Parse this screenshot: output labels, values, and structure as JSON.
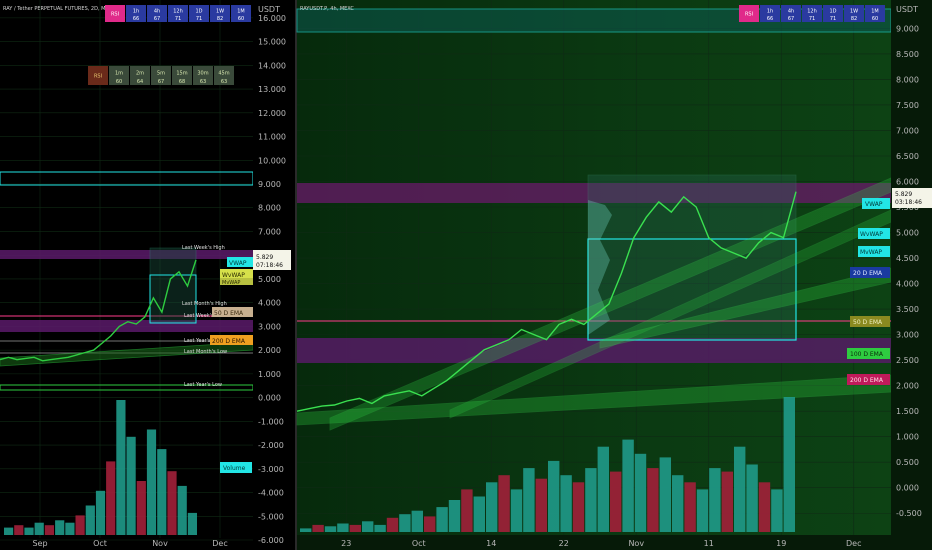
{
  "left_panel": {
    "title": "RAY / Tether PERPETUAL FUTURES, 2D, MEXC",
    "price_axis_title": "USDT",
    "rsi_row_top": {
      "label": "RSI",
      "cells": [
        {
          "tf": "1h",
          "val": "66"
        },
        {
          "tf": "4h",
          "val": "67"
        },
        {
          "tf": "12h",
          "val": "71"
        },
        {
          "tf": "1D",
          "val": "71"
        },
        {
          "tf": "1W",
          "val": "82"
        },
        {
          "tf": "1M",
          "val": "60"
        }
      ]
    },
    "rsi_row_mid": {
      "label": "RSI",
      "cells": [
        {
          "tf": "1m",
          "val": "60"
        },
        {
          "tf": "2m",
          "val": "64"
        },
        {
          "tf": "5m",
          "val": "67"
        },
        {
          "tf": "15m",
          "val": "68"
        },
        {
          "tf": "30m",
          "val": "63"
        },
        {
          "tf": "45m",
          "val": "63"
        }
      ]
    },
    "price_label": {
      "price": "5.829",
      "countdown": "07:18:46"
    },
    "level_tags": [
      {
        "text": "VWAP",
        "kind": "cyan"
      },
      {
        "text": "WvWAP",
        "kind": "yellow"
      },
      {
        "text": "MvWAP",
        "kind": "yellow"
      },
      {
        "text": "50 D EMA",
        "kind": "tan"
      },
      {
        "text": "200 D EMA",
        "kind": "orange"
      }
    ],
    "level_texts": [
      "Last Week's High",
      "Last Month's High",
      "Last Week's Low",
      "Last Year's High",
      "Last Month's Low",
      "Last Year's Low"
    ],
    "volume_label": "Volume"
  },
  "right_panel": {
    "title": "RAYUSDT.P, 4h, MEXC",
    "price_axis_title": "USDT",
    "rsi_row": {
      "label": "RSI",
      "cells": [
        {
          "tf": "1h",
          "val": "66"
        },
        {
          "tf": "4h",
          "val": "67"
        },
        {
          "tf": "12h",
          "val": "71"
        },
        {
          "tf": "1D",
          "val": "71"
        },
        {
          "tf": "1W",
          "val": "82"
        },
        {
          "tf": "1M",
          "val": "60"
        }
      ]
    },
    "price_label": {
      "price": "5.829",
      "countdown": "03:18:46"
    },
    "level_tags": [
      {
        "text": "VWAP",
        "kind": "cyan"
      },
      {
        "text": "WvWAP",
        "kind": "cyan"
      },
      {
        "text": "MvWAP",
        "kind": "cyan"
      },
      {
        "text": "20 D EMA",
        "kind": "blue"
      },
      {
        "text": "50 D EMA",
        "kind": "olive"
      },
      {
        "text": "100 D EMA",
        "kind": "green"
      },
      {
        "text": "200 D EMA",
        "kind": "pink"
      }
    ]
  },
  "chart_data": [
    {
      "type": "line",
      "title": "RAY / Tether PERPETUAL FUTURES, 2D, MEXC",
      "xlabel": "",
      "ylabel": "USDT",
      "x_ticks": [
        "Sep",
        "Oct",
        "Nov",
        "Dec"
      ],
      "y_ticks": [
        "16.000",
        "15.000",
        "14.000",
        "13.000",
        "12.000",
        "11.000",
        "10.000",
        "9.000",
        "8.000",
        "7.000",
        "6.000",
        "5.000",
        "4.000",
        "3.000",
        "2.000",
        "1.000",
        "0.000",
        "-1.000",
        "-2.000",
        "-3.000",
        "-4.000",
        "-5.000",
        "-6.000"
      ],
      "ylim": [
        -6,
        16.5
      ],
      "series": [
        {
          "values": [
            1.6,
            1.7,
            1.6,
            1.65,
            1.7,
            1.55,
            1.6,
            1.65,
            1.7,
            1.8,
            1.9,
            2.0,
            2.3,
            2.6,
            3.0,
            3.2,
            3.1,
            3.4,
            4.2,
            3.6,
            5.0,
            5.3,
            4.7,
            5.8
          ]
        }
      ],
      "volume": [
        0.3,
        0.4,
        0.3,
        0.5,
        0.4,
        0.6,
        0.5,
        0.8,
        1.2,
        1.8,
        3.0,
        5.5,
        4.0,
        2.2,
        4.3,
        3.5,
        2.6,
        2.0,
        0.9
      ],
      "grid": true
    },
    {
      "type": "line",
      "title": "RAYUSDT.P, 4h, MEXC",
      "xlabel": "",
      "ylabel": "USDT",
      "x_ticks": [
        "23",
        "Oct",
        "14",
        "22",
        "Nov",
        "11",
        "19",
        "Dec"
      ],
      "y_ticks": [
        "9.000",
        "8.500",
        "8.000",
        "7.500",
        "7.000",
        "6.500",
        "6.000",
        "5.500",
        "5.000",
        "4.500",
        "4.000",
        "3.500",
        "3.000",
        "2.500",
        "2.000",
        "1.500",
        "1.000",
        "0.500",
        "0.000",
        "-0.500"
      ],
      "ylim": [
        -0.75,
        9.4
      ],
      "series": [
        {
          "values": [
            1.5,
            1.55,
            1.6,
            1.62,
            1.7,
            1.75,
            1.65,
            1.8,
            1.85,
            1.9,
            1.8,
            1.95,
            2.1,
            2.3,
            2.5,
            2.7,
            2.8,
            2.9,
            3.1,
            3.0,
            2.9,
            3.2,
            3.3,
            3.2,
            3.4,
            3.6,
            4.2,
            4.9,
            5.3,
            5.6,
            5.4,
            5.7,
            5.5,
            4.9,
            4.7,
            4.6,
            4.5,
            4.8,
            5.0,
            4.9,
            5.8
          ]
        }
      ],
      "volume": [
        0.05,
        0.1,
        0.08,
        0.12,
        0.1,
        0.15,
        0.1,
        0.2,
        0.25,
        0.3,
        0.22,
        0.35,
        0.45,
        0.6,
        0.5,
        0.7,
        0.8,
        0.6,
        0.9,
        0.75,
        1.0,
        0.8,
        0.7,
        0.9,
        1.2,
        0.85,
        1.3,
        1.1,
        0.9,
        1.05,
        0.8,
        0.7,
        0.6,
        0.9,
        0.85,
        1.2,
        0.95,
        0.7,
        0.6,
        1.9
      ],
      "grid": true
    }
  ],
  "colors": {
    "bg": "#000000",
    "grid": "#0f2a14",
    "green": "#2ecc40",
    "cyan": "#22e5e5",
    "purple": "#7a2a8a",
    "teal_vol": "#1f9a8a",
    "red_vol": "#a2203a",
    "pink": "#ff3c8c"
  }
}
